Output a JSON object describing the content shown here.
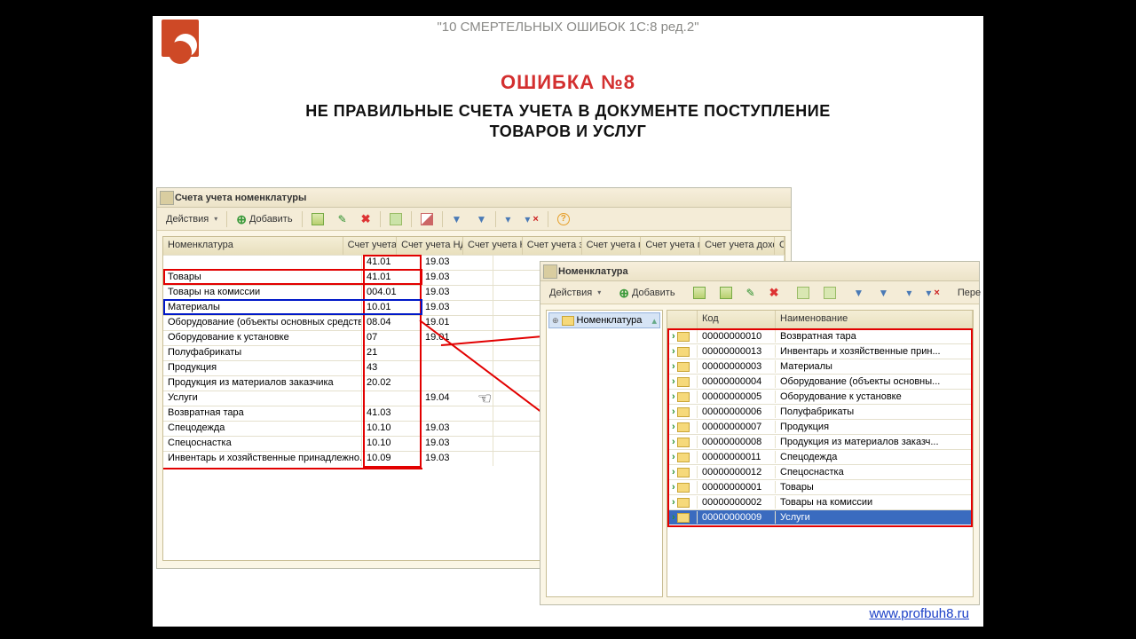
{
  "pretitle": "\"10 СМЕРТЕЛЬНЫХ ОШИБОК 1С:8 ред.2\"",
  "title": "ОШИБКА №8",
  "subtitle_l1": "НЕ ПРАВИЛЬНЫЕ СЧЕТА УЧЕТА В ДОКУМЕНТЕ ПОСТУПЛЕНИЕ",
  "subtitle_l2": "ТОВАРОВ И УСЛУГ",
  "footer_link": "www.profbuh8.ru",
  "win1": {
    "title": "Счета учета номенклатуры",
    "toolbar": {
      "actions": "Действия",
      "add": "Добавить"
    },
    "headers": {
      "nom": "Номенклатура",
      "acc": "Счет учета",
      "vat": "Счет учета НДС ...",
      "c3": "Счет учета Н...",
      "c4": "Счет учета з...",
      "c5": "Счет учета п...",
      "c6": "Счет учета п...",
      "c7": "Счет учета дохо...",
      "c8": "Счет"
    },
    "rows": [
      {
        "nom": "",
        "acc": "41.01",
        "vat": "19.03"
      },
      {
        "nom": "Товары",
        "acc": "41.01",
        "vat": "19.03"
      },
      {
        "nom": "Товары на комиссии",
        "acc": "004.01",
        "vat": "19.03"
      },
      {
        "nom": "Материалы",
        "acc": "10.01",
        "vat": "19.03"
      },
      {
        "nom": "Оборудование (объекты основных средств)",
        "acc": "08.04",
        "vat": "19.01"
      },
      {
        "nom": "Оборудование к установке",
        "acc": "07",
        "vat": "19.01"
      },
      {
        "nom": "Полуфабрикаты",
        "acc": "21",
        "vat": ""
      },
      {
        "nom": "Продукция",
        "acc": "43",
        "vat": ""
      },
      {
        "nom": "Продукция из материалов заказчика",
        "acc": "20.02",
        "vat": ""
      },
      {
        "nom": "Услуги",
        "acc": "",
        "vat": "19.04"
      },
      {
        "nom": "Возвратная тара",
        "acc": "41.03",
        "vat": ""
      },
      {
        "nom": "Спецодежда",
        "acc": "10.10",
        "vat": "19.03"
      },
      {
        "nom": "Спецоснастка",
        "acc": "10.10",
        "vat": "19.03"
      },
      {
        "nom": "Инвентарь и хозяйственные принадлежно...",
        "acc": "10.09",
        "vat": "19.03"
      }
    ]
  },
  "win2": {
    "title": "Номенклатура",
    "toolbar": {
      "actions": "Действия",
      "add": "Добавить",
      "more": "Пере"
    },
    "tree_root": "Номенклатура",
    "headers": {
      "code": "Код",
      "name": "Наименование"
    },
    "rows": [
      {
        "code": "00000000010",
        "name": "Возвратная тара"
      },
      {
        "code": "00000000013",
        "name": "Инвентарь и хозяйственные прин..."
      },
      {
        "code": "00000000003",
        "name": "Материалы"
      },
      {
        "code": "00000000004",
        "name": "Оборудование (объекты основны..."
      },
      {
        "code": "00000000005",
        "name": "Оборудование к установке"
      },
      {
        "code": "00000000006",
        "name": "Полуфабрикаты"
      },
      {
        "code": "00000000007",
        "name": "Продукция"
      },
      {
        "code": "00000000008",
        "name": "Продукция из материалов заказч..."
      },
      {
        "code": "00000000011",
        "name": "Спецодежда"
      },
      {
        "code": "00000000012",
        "name": "Спецоснастка"
      },
      {
        "code": "00000000001",
        "name": "Товары"
      },
      {
        "code": "00000000002",
        "name": "Товары на комиссии"
      },
      {
        "code": "00000000009",
        "name": "Услуги"
      }
    ],
    "selected_index": 12
  }
}
